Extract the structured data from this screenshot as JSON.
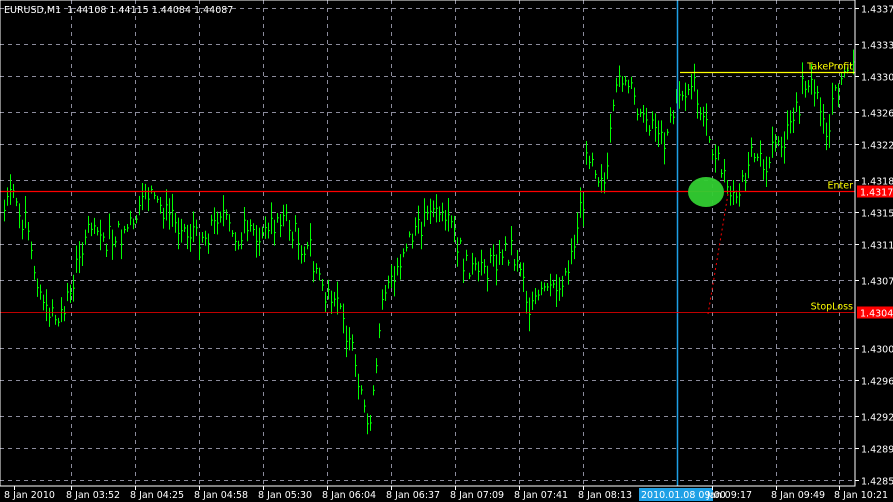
{
  "header": {
    "symbol": "EURUSD,M1",
    "ohlc": "1.44108 1.44115 1.44084 1.44087"
  },
  "colors": {
    "background": "#000000",
    "bars": "#00ff00",
    "grid": "#8c8c9c",
    "enter_line": "#ff0000",
    "stoploss_line": "#ff0000",
    "takeprofit_line": "#ffff00",
    "cursor_line": "#1ea0e6",
    "marker": "#32cd32",
    "axis": "#ffffff"
  },
  "chart_data": {
    "type": "bar",
    "title": "EURUSD,M1",
    "ylim": [
      1.42855,
      1.43375
    ],
    "y_ticks": [
      "1.43375",
      "1.43335",
      "1.43300",
      "1.43260",
      "1.43225",
      "1.43185",
      "1.43150",
      "1.43115",
      "1.43075",
      "1.43000",
      "1.42965",
      "1.42925",
      "1.42890",
      "1.42855"
    ],
    "x_ticks": [
      "8 Jan 2010",
      "8 Jan 03:52",
      "8 Jan 04:25",
      "8 Jan 04:58",
      "8 Jan 05:30",
      "8 Jan 06:04",
      "8 Jan 06:37",
      "8 Jan 07:09",
      "8 Jan 07:41",
      "8 Jan 08:13",
      "2010.01.08 09:00",
      "Jan 09:17",
      "8 Jan 09:49",
      "8 Jan 10:21"
    ],
    "price_path": [
      1.43158,
      1.43169,
      1.43108,
      1.43053,
      1.43031,
      1.43075,
      1.4313,
      1.43119,
      1.4313,
      1.43136,
      1.43175,
      1.43153,
      1.4313,
      1.43125,
      1.4313,
      1.43153,
      1.43119,
      1.4313,
      1.43125,
      1.43147,
      1.43125,
      1.43108,
      1.43064,
      1.43042,
      1.43009,
      1.42899,
      1.43053,
      1.43097,
      1.4313,
      1.43147,
      1.43147,
      1.43119,
      1.43086,
      1.43092,
      1.43108,
      1.43097,
      1.43053,
      1.43064,
      1.43075,
      1.43108,
      1.43219,
      1.43175,
      1.43307,
      1.43274,
      1.43252,
      1.4323,
      1.43274,
      1.43285,
      1.43241,
      1.43197,
      1.43164,
      1.43219,
      1.43197,
      1.4323,
      1.43263,
      1.43296,
      1.43241,
      1.43296,
      1.43318
    ],
    "levels": [
      {
        "name": "TakeProfit",
        "price": 1.43305
      },
      {
        "name": "Enter",
        "price": 1.43173,
        "label": "1.43173"
      },
      {
        "name": "StopLoss",
        "price": 1.4304,
        "label": "1.43040"
      }
    ],
    "cursor_time": "2010.01.08 09:00",
    "grid": true
  }
}
